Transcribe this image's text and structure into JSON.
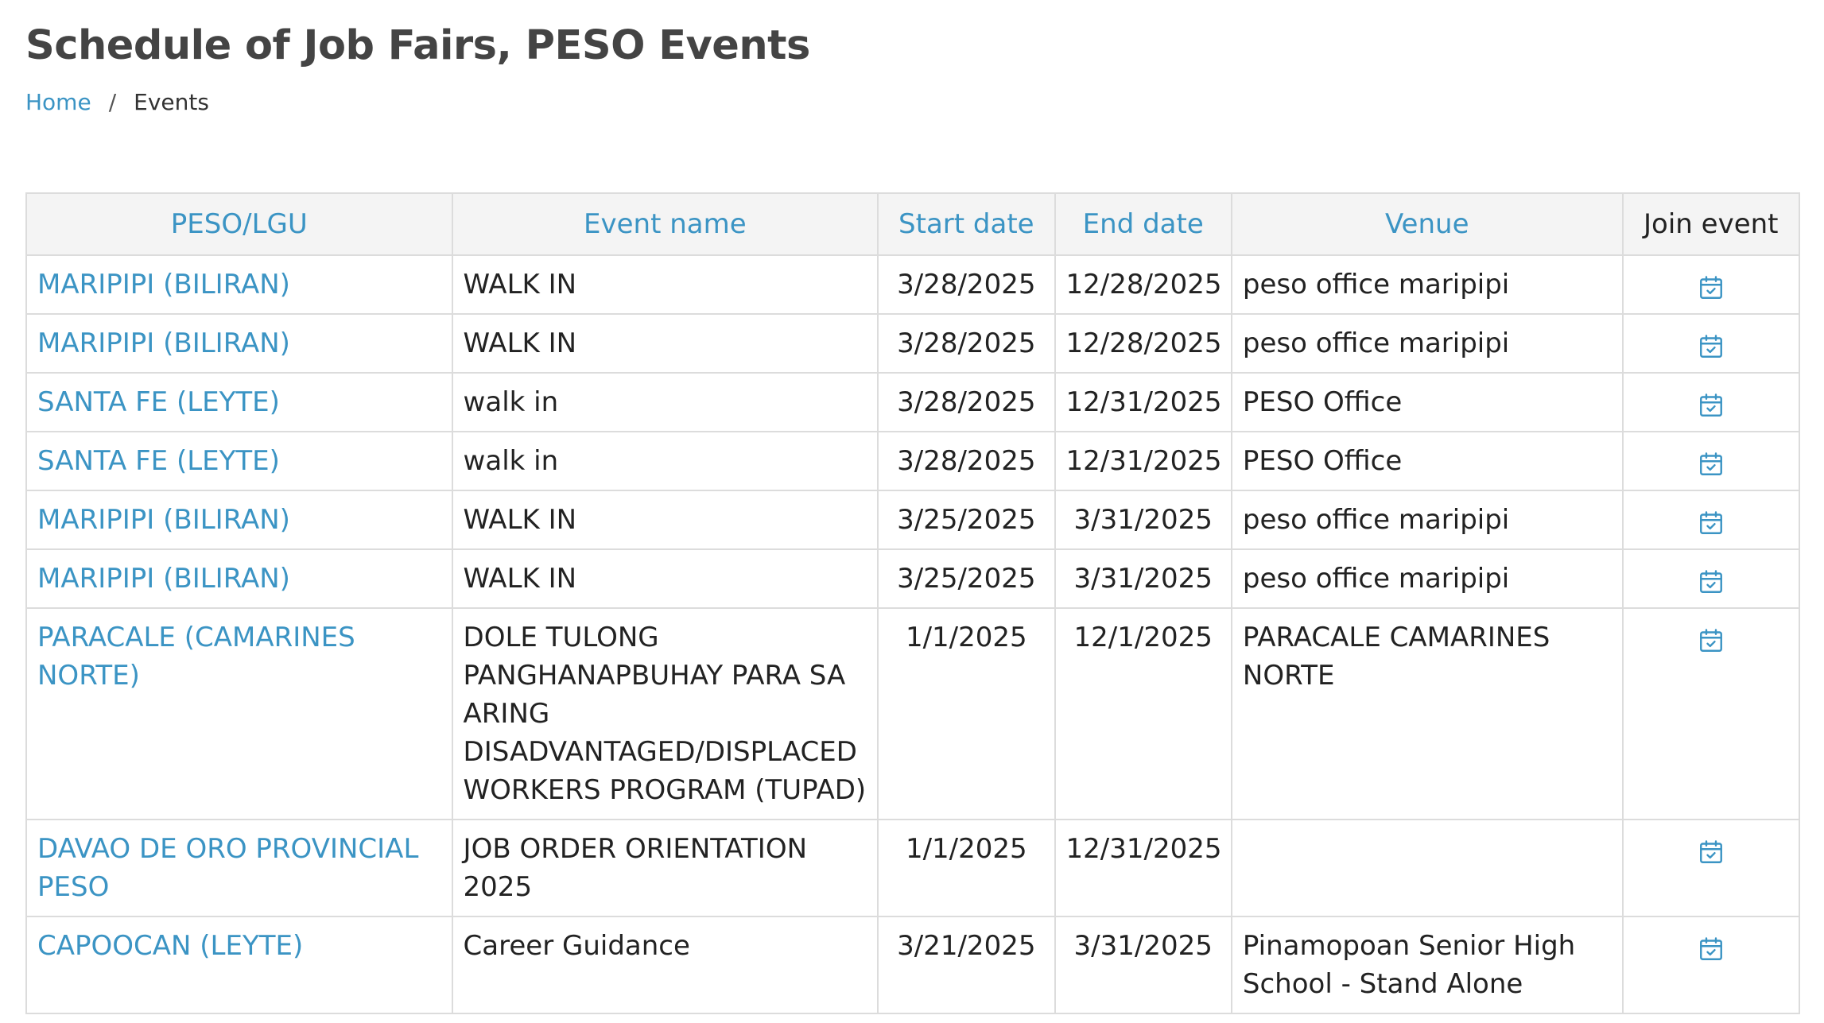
{
  "page": {
    "title": "Schedule of Job Fairs, PESO Events"
  },
  "breadcrumb": {
    "home": "Home",
    "separator": "/",
    "current": "Events"
  },
  "table": {
    "headers": {
      "lgu": "PESO/LGU",
      "event": "Event name",
      "start": "Start date",
      "end": "End date",
      "venue": "Venue",
      "join": "Join event"
    },
    "rows": [
      {
        "lgu": "MARIPIPI (BILIRAN)",
        "event": "WALK IN",
        "start": "3/28/2025",
        "end": "12/28/2025",
        "venue": "peso office maripipi",
        "join_icon": "calendar-check-icon"
      },
      {
        "lgu": "MARIPIPI (BILIRAN)",
        "event": "WALK IN",
        "start": "3/28/2025",
        "end": "12/28/2025",
        "venue": "peso office maripipi",
        "join_icon": "calendar-check-icon"
      },
      {
        "lgu": "SANTA FE (LEYTE)",
        "event": "walk in",
        "start": "3/28/2025",
        "end": "12/31/2025",
        "venue": "PESO Office",
        "join_icon": "calendar-check-icon"
      },
      {
        "lgu": "SANTA FE (LEYTE)",
        "event": "walk in",
        "start": "3/28/2025",
        "end": "12/31/2025",
        "venue": "PESO Office",
        "join_icon": "calendar-check-icon"
      },
      {
        "lgu": "MARIPIPI (BILIRAN)",
        "event": "WALK IN",
        "start": "3/25/2025",
        "end": "3/31/2025",
        "venue": "peso office maripipi",
        "join_icon": "calendar-check-icon"
      },
      {
        "lgu": "MARIPIPI (BILIRAN)",
        "event": "WALK IN",
        "start": "3/25/2025",
        "end": "3/31/2025",
        "venue": "peso office maripipi",
        "join_icon": "calendar-check-icon"
      },
      {
        "lgu": "PARACALE (CAMARINES NORTE)",
        "event": "DOLE TULONG PANGHANAPBUHAY PARA SA ARING DISADVANTAGED/DISPLACED WORKERS PROGRAM (TUPAD)",
        "start": "1/1/2025",
        "end": "12/1/2025",
        "venue": "PARACALE CAMARINES NORTE",
        "join_icon": "calendar-check-icon"
      },
      {
        "lgu": "DAVAO DE ORO PROVINCIAL PESO",
        "event": "JOB ORDER ORIENTATION 2025",
        "start": "1/1/2025",
        "end": "12/31/2025",
        "venue": "",
        "join_icon": "calendar-check-icon"
      },
      {
        "lgu": "CAPOOCAN (LEYTE)",
        "event": "Career Guidance",
        "start": "3/21/2025",
        "end": "3/31/2025",
        "venue": "Pinamopoan Senior High School - Stand Alone",
        "join_icon": "calendar-check-icon"
      }
    ]
  },
  "colors": {
    "link": "#3b94c4",
    "header_bg": "#f4f4f4",
    "border": "#dcdcdc",
    "title": "#444444"
  }
}
